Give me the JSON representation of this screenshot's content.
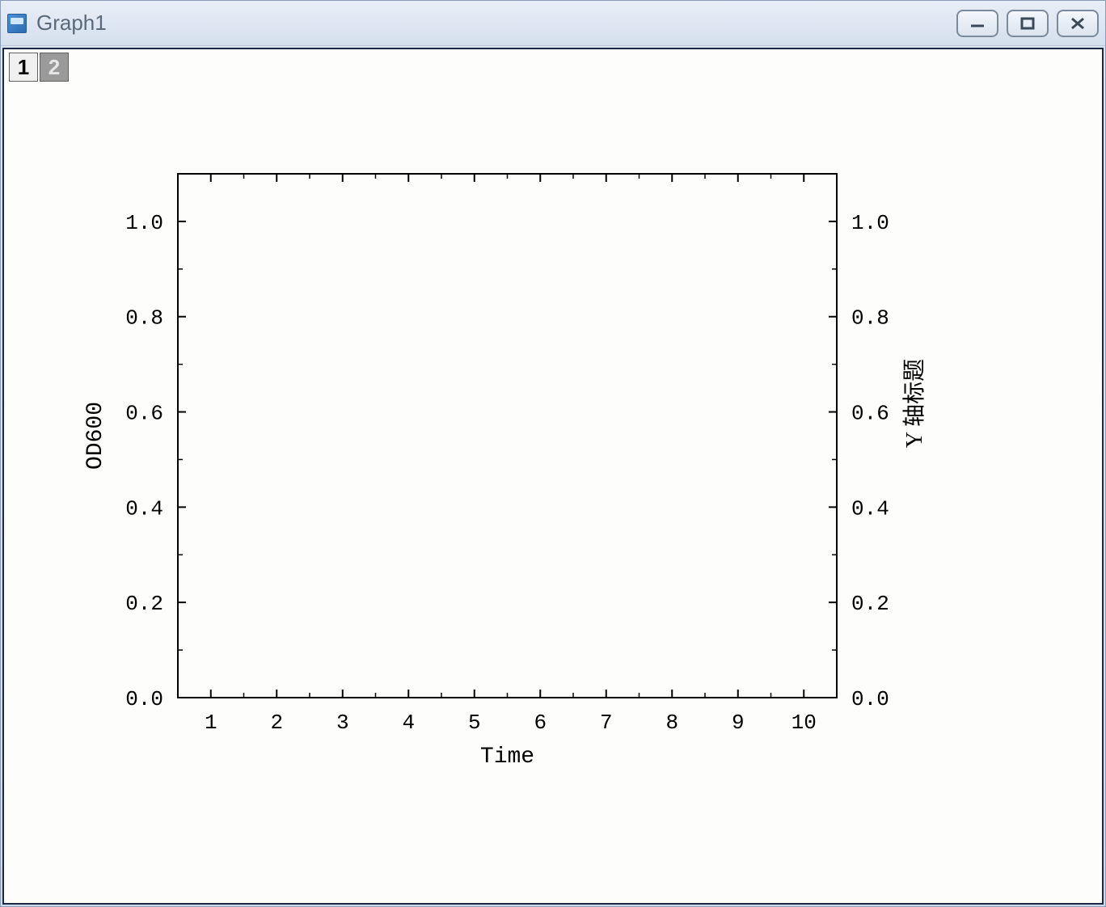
{
  "window": {
    "title": "Graph1"
  },
  "tabs": {
    "t1": "1",
    "t2": "2"
  },
  "chart_data": {
    "type": "line",
    "series": [],
    "x_ticks": [
      1,
      2,
      3,
      4,
      5,
      6,
      7,
      8,
      9,
      10
    ],
    "y_ticks": [
      "0.0",
      "0.2",
      "0.4",
      "0.6",
      "0.8",
      "1.0"
    ],
    "y2_ticks": [
      "0.0",
      "0.2",
      "0.4",
      "0.6",
      "0.8",
      "1.0"
    ],
    "xlabel": "Time",
    "ylabel": "OD600",
    "y2label": "Y 轴标题",
    "xlim": [
      0.5,
      10.5
    ],
    "ylim": [
      0.0,
      1.1
    ],
    "y2lim": [
      0.0,
      1.1
    ]
  }
}
